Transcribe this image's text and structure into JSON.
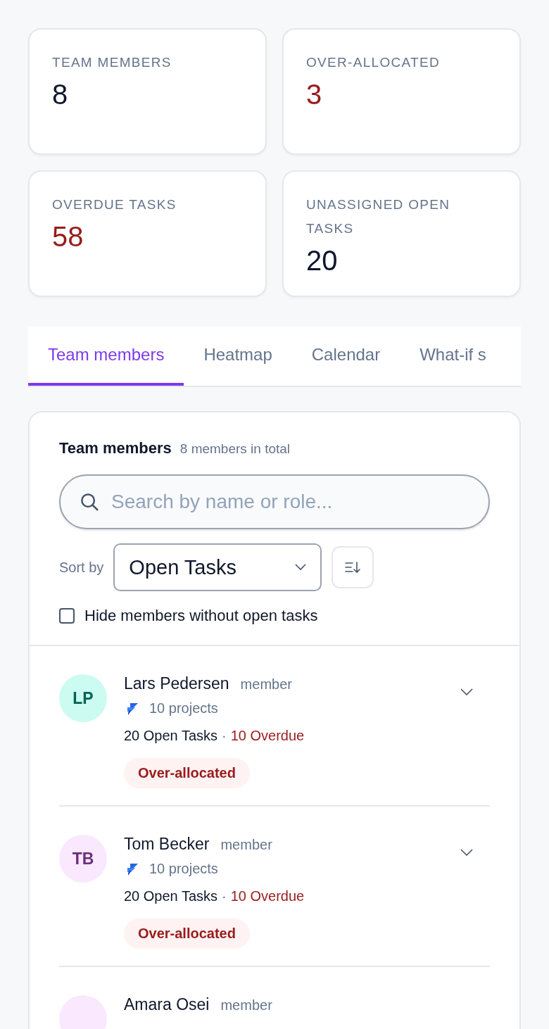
{
  "stats": [
    {
      "label": "TEAM MEMBERS",
      "value": "8",
      "alert": false
    },
    {
      "label": "OVER-ALLOCATED",
      "value": "3",
      "alert": true
    },
    {
      "label": "OVERDUE TASKS",
      "value": "58",
      "alert": true
    },
    {
      "label": "UNASSIGNED OPEN TASKS",
      "value": "20",
      "alert": false
    }
  ],
  "tabs": [
    {
      "label": "Team members",
      "selected": true
    },
    {
      "label": "Heatmap",
      "selected": false
    },
    {
      "label": "Calendar",
      "selected": false
    },
    {
      "label": "What-if s",
      "selected": false
    }
  ],
  "panel": {
    "title": "Team members",
    "subtitle": "8 members in total",
    "search": {
      "placeholder": "Search by name or role..."
    },
    "sort_label": "Sort by",
    "sort_value": "Open Tasks",
    "hide_checkbox": {
      "label": "Hide members without open tasks",
      "checked": false
    },
    "members": [
      {
        "initials": "LP",
        "color": "#ccfbf1",
        "name": "Lars Pedersen",
        "role": "member",
        "projects": "10 projects",
        "open_tasks": "20 Open Tasks",
        "separator": "·",
        "overdue": "10 Overdue",
        "badge": "Over-allocated"
      },
      {
        "initials": "TB",
        "color": "#fae8ff",
        "name": "Tom Becker",
        "role": "member",
        "projects": "10 projects",
        "open_tasks": "20 Open Tasks",
        "separator": "·",
        "overdue": "10 Overdue",
        "badge": "Over-allocated"
      },
      {
        "color": "#fae8ff",
        "name": "Amara Osei",
        "role": "member"
      }
    ]
  }
}
